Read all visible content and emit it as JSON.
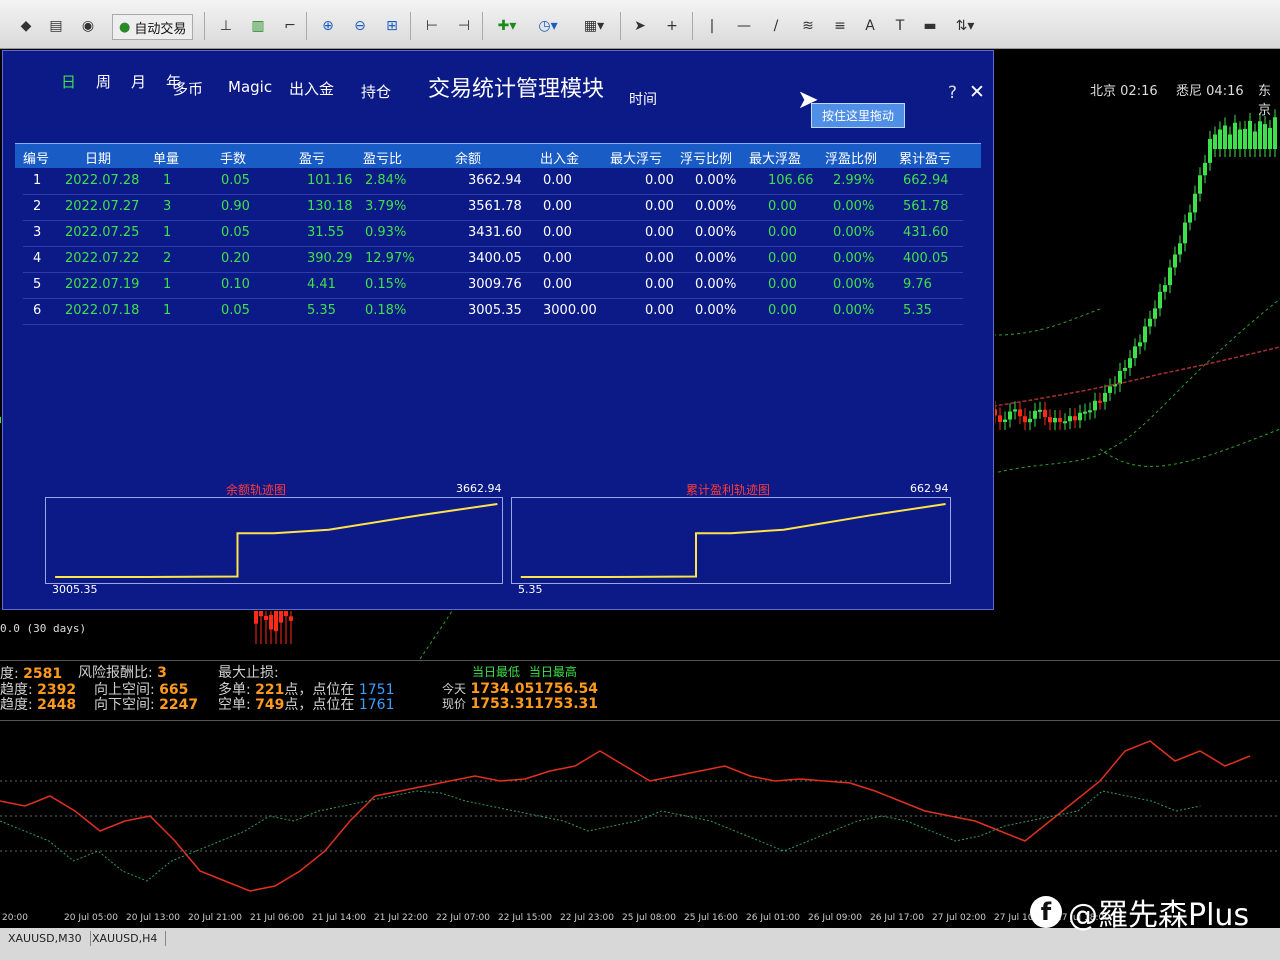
{
  "toolbar": {
    "auto_trade_label": "自动交易"
  },
  "clocks": [
    {
      "city": "北京",
      "time": "02:16"
    },
    {
      "city": "悉尼",
      "time": "04:16"
    },
    {
      "city": "东京",
      "time": ""
    }
  ],
  "dialog": {
    "title": "交易统计管理模块",
    "help_glyph": "?",
    "close_glyph": "✕",
    "drag_tip": "按住这里拖动",
    "periods": [
      "日",
      "周",
      "月",
      "年"
    ],
    "active_period": "日",
    "top_labels": [
      "多币",
      "Magic",
      "出入金",
      "持仓"
    ],
    "time_label": "时间",
    "columns": [
      "编号",
      "日期",
      "单量",
      "手数",
      "盈亏",
      "盈亏比",
      "余额",
      "出入金",
      "最大浮亏",
      "浮亏比例",
      "最大浮盈",
      "浮盈比例",
      "累计盈亏"
    ],
    "rows": [
      {
        "no": "1",
        "date": "2022.07.28",
        "count": "1",
        "lots": "0.05",
        "pl": "101.16",
        "pl_ratio": "2.84%",
        "balance": "3662.94",
        "deposit": "0.00",
        "max_dd": "0.00",
        "dd_ratio": "0.00%",
        "max_fp": "106.66",
        "fp_ratio": "2.99%",
        "cum_pl": "662.94"
      },
      {
        "no": "2",
        "date": "2022.07.27",
        "count": "3",
        "lots": "0.90",
        "pl": "130.18",
        "pl_ratio": "3.79%",
        "balance": "3561.78",
        "deposit": "0.00",
        "max_dd": "0.00",
        "dd_ratio": "0.00%",
        "max_fp": "0.00",
        "fp_ratio": "0.00%",
        "cum_pl": "561.78"
      },
      {
        "no": "3",
        "date": "2022.07.25",
        "count": "1",
        "lots": "0.05",
        "pl": "31.55",
        "pl_ratio": "0.93%",
        "balance": "3431.60",
        "deposit": "0.00",
        "max_dd": "0.00",
        "dd_ratio": "0.00%",
        "max_fp": "0.00",
        "fp_ratio": "0.00%",
        "cum_pl": "431.60"
      },
      {
        "no": "4",
        "date": "2022.07.22",
        "count": "2",
        "lots": "0.20",
        "pl": "390.29",
        "pl_ratio": "12.97%",
        "balance": "3400.05",
        "deposit": "0.00",
        "max_dd": "0.00",
        "dd_ratio": "0.00%",
        "max_fp": "0.00",
        "fp_ratio": "0.00%",
        "cum_pl": "400.05"
      },
      {
        "no": "5",
        "date": "2022.07.19",
        "count": "1",
        "lots": "0.10",
        "pl": "4.41",
        "pl_ratio": "0.15%",
        "balance": "3009.76",
        "deposit": "0.00",
        "max_dd": "0.00",
        "dd_ratio": "0.00%",
        "max_fp": "0.00",
        "fp_ratio": "0.00%",
        "cum_pl": "9.76"
      },
      {
        "no": "6",
        "date": "2022.07.18",
        "count": "1",
        "lots": "0.05",
        "pl": "5.35",
        "pl_ratio": "0.18%",
        "balance": "3005.35",
        "deposit": "3000.00",
        "max_dd": "0.00",
        "dd_ratio": "0.00%",
        "max_fp": "0.00",
        "fp_ratio": "0.00%",
        "cum_pl": "5.35"
      }
    ],
    "balance_chart": {
      "title": "余额轨迹图",
      "max_label": "3662.94",
      "min_label": "3005.35",
      "values": [
        3005.35,
        3005.35,
        3009.76,
        3400.05,
        3400.05,
        3431.6,
        3561.78,
        3662.94
      ],
      "line_color": "#ffe34a"
    },
    "profit_chart": {
      "title": "累计盈利轨迹图",
      "max_label": "662.94",
      "min_label": "5.35",
      "values": [
        5.35,
        5.35,
        9.76,
        400.05,
        400.05,
        431.6,
        561.78,
        662.94
      ],
      "line_color": "#ffe34a"
    }
  },
  "left_text": "0.0   (30 days)",
  "info": {
    "l1_label": "度:",
    "l1_value": "2581",
    "l2_label": "趋度:",
    "l2_value": "2392",
    "l3_label": "趋度:",
    "l3_value": "2448",
    "risk_label": "风险报酬比:",
    "risk_value": "3",
    "up_label": "向上空间:",
    "up_value": "665",
    "down_label": "向下空间:",
    "down_value": "2247",
    "maxstop_label": "最大止损:",
    "long_label": "多单:",
    "long_value": "221",
    "long_suffix": "点，点位在",
    "long_pos": "1751",
    "short_label": "空单:",
    "short_value": "749",
    "short_suffix": "点，点位在",
    "short_pos": "1761",
    "day_low_label": "当日最低",
    "day_high_label": "当日最高",
    "today_label": "今天",
    "today_low": "1734.05",
    "today_high": "1756.54",
    "now_label": "现价",
    "now_low": "1753.31",
    "now_high": "1753.31"
  },
  "time_axis": [
    "20:00",
    "20 Jul 05:00",
    "20 Jul 13:00",
    "20 Jul 21:00",
    "21 Jul 06:00",
    "21 Jul 14:00",
    "21 Jul 22:00",
    "22 Jul 07:00",
    "22 Jul 15:00",
    "22 Jul 23:00",
    "25 Jul 08:00",
    "25 Jul 16:00",
    "26 Jul 01:00",
    "26 Jul 09:00",
    "26 Jul 17:00",
    "27 Jul 02:00",
    "27 Jul 10:00",
    "27 Jul 18:00"
  ],
  "symbol_tabs": [
    "XAUUSD,M30",
    "XAUUSD,H4"
  ],
  "watermark": "@羅先森Plus"
}
